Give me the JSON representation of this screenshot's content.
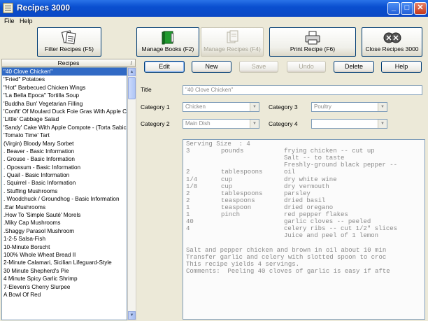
{
  "window": {
    "title": "Recipes 3000",
    "min": "_",
    "max": "□",
    "close": "✕"
  },
  "menu": {
    "file": "File",
    "help": "Help"
  },
  "toolbar": {
    "filter": "Filter Recipes (F5)",
    "manage_books": "Manage Books (F2)",
    "manage_recipes": "Manage Recipes (F4)",
    "print": "Print Recipe (F6)",
    "close": "Close Recipes 3000"
  },
  "list": {
    "header": "Recipes",
    "sort_glyph": "/",
    "items": [
      "\"40 Clove Chicken\"",
      "\"Fried\" Potatoes",
      "\"Hot\" Barbecued Chicken Wings",
      "\"La Bella Epoca\" Tortilla Soup",
      "'Buddha Bun' Vegetarian Filling",
      "'Confit' Of Moulard Duck Foie Gras With Apple C",
      "'Little' Cabbage Salad",
      "'Sandy' Cake With Apple Compote - (Torta Sabic",
      "'Tomato Time' Tart",
      "(Virgin) Bloody Mary Sorbet",
      ". Beaver - Basic Information",
      ". Grouse - Basic Information",
      ". Opossum - Basic Information",
      ". Quail - Basic Information",
      ". Squirrel - Basic Information",
      ". Stuffing Mushrooms",
      ". Woodchuck / Groundhog - Basic Information",
      ".Ear Mushrooms",
      ".How To 'Simple Sauté' Morels",
      ".Miky Cap Mushrooms",
      ".Shaggy Parasol Mushroom",
      "1-2-5 Salsa-Fish",
      "10-Minute Borscht",
      "100% Whole Wheat Bread II",
      "2-Minute Calamari, Sicilian Lifeguard-Style",
      "30 Minute Shepherd's Pie",
      "4 Minute Spicy Garlic Shrimp",
      "7-Eleven's Cherry Slurpee",
      "A Bowl Of Red"
    ],
    "selected_index": 0,
    "scroll_up": "▲",
    "scroll_down": "▼"
  },
  "actions": {
    "edit": "Edit",
    "new": "New",
    "save": "Save",
    "undo": "Undo",
    "delete": "Delete",
    "help": "Help"
  },
  "form": {
    "title_label": "Title",
    "title_value": "\"40 Clove Chicken\"",
    "cat1_label": "Category 1",
    "cat1_value": "Chicken",
    "cat2_label": "Category 2",
    "cat2_value": "Main Dish",
    "cat3_label": "Category 3",
    "cat3_value": "Poultry",
    "cat4_label": "Category 4",
    "cat4_value": "",
    "dropdown_glyph": "▼"
  },
  "recipe": {
    "serving": "Serving Size  : 4",
    "ingredients": [
      {
        "qty": "3",
        "unit": "pounds",
        "desc": "frying chicken -- cut up"
      },
      {
        "qty": "",
        "unit": "",
        "desc": "Salt -- to taste"
      },
      {
        "qty": "",
        "unit": "",
        "desc": "Freshly-ground black pepper --"
      },
      {
        "qty": "2",
        "unit": "tablespoons",
        "desc": "oil"
      },
      {
        "qty": "1/4",
        "unit": "cup",
        "desc": "dry white wine"
      },
      {
        "qty": "1/8",
        "unit": "cup",
        "desc": "dry vermouth"
      },
      {
        "qty": "2",
        "unit": "tablespoons",
        "desc": "parsley"
      },
      {
        "qty": "2",
        "unit": "teaspoons",
        "desc": "dried basil"
      },
      {
        "qty": "1",
        "unit": "teaspoon",
        "desc": "dried oregano"
      },
      {
        "qty": "1",
        "unit": "pinch",
        "desc": "red pepper flakes"
      },
      {
        "qty": "40",
        "unit": "",
        "desc": "garlic cloves -- peeled"
      },
      {
        "qty": "4",
        "unit": "",
        "desc": "celery ribs -- cut 1/2\" slices"
      },
      {
        "qty": "",
        "unit": "",
        "desc": "Juice and peel of 1 lemon"
      }
    ],
    "directions": [
      "Salt and pepper chicken and brown in oil about 10 min",
      "Transfer garlic and celery with slotted spoon to croc",
      "This recipe yields 4 servings.",
      "Comments:  Peeling 40 cloves of garlic is easy if afte"
    ]
  }
}
